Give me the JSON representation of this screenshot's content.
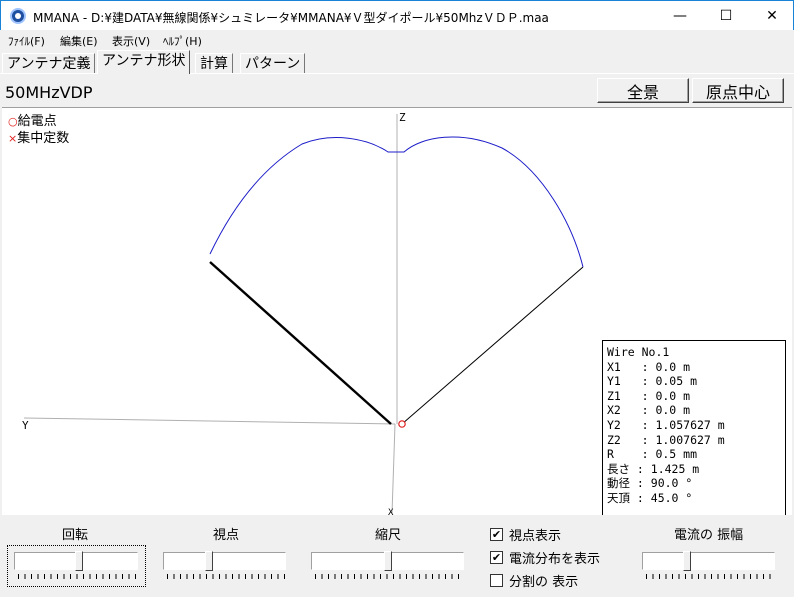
{
  "window": {
    "title": "MMANA - D:¥建DATA¥無線関係¥シュミレータ¥MMANA¥Ｖ型ダイポール¥50MhzＶＤＰ.maa",
    "minimize_glyph": "—",
    "maximize_glyph": "☐",
    "close_glyph": "✕"
  },
  "menu": {
    "items": [
      "ﾌｧｲﾙ(F)",
      "編集(E)",
      "表示(V)",
      "ﾍﾙﾌﾟ(H)"
    ]
  },
  "tabs": {
    "items": [
      "アンテナ定義",
      "アンテナ形状",
      "計算",
      "パターン"
    ],
    "active_index": 1
  },
  "header": {
    "model_name": "50MHzVDP",
    "full_view_button": "全景",
    "origin_center_button": "原点中心"
  },
  "view": {
    "legend_feed_mark": "○",
    "legend_feed_label": "給電点",
    "legend_load_mark": "×",
    "legend_load_label": "集中定数",
    "axis_z_label": "Z",
    "axis_y_label": "Y",
    "axis_x_label": "X",
    "current_color": "#1c1cc8",
    "selected_wire_color": "#000000",
    "feed_color": "#e02020"
  },
  "wire_info": {
    "lines": [
      "Wire No.1",
      "X1   : 0.0 m",
      "Y1   : 0.05 m",
      "Z1   : 0.0 m",
      "X2   : 0.0 m",
      "Y2   : 1.057627 m",
      "Z2   : 1.007627 m",
      "R    : 0.5 mm",
      "長さ : 1.425 m",
      "動径 : 90.0 °",
      "天頂 : 45.0 °"
    ]
  },
  "controls": {
    "rotate_label": "回転",
    "viewpoint_label": "視点",
    "scale_label": "縮尺",
    "current_amp_label": "電流の 振幅",
    "checkboxes": [
      {
        "label": "視点表示",
        "checked": true,
        "mark": "✔"
      },
      {
        "label": "電流分布を表示",
        "checked": true,
        "mark": "✔"
      },
      {
        "label": "分割の 表示",
        "checked": false,
        "mark": ""
      }
    ]
  }
}
